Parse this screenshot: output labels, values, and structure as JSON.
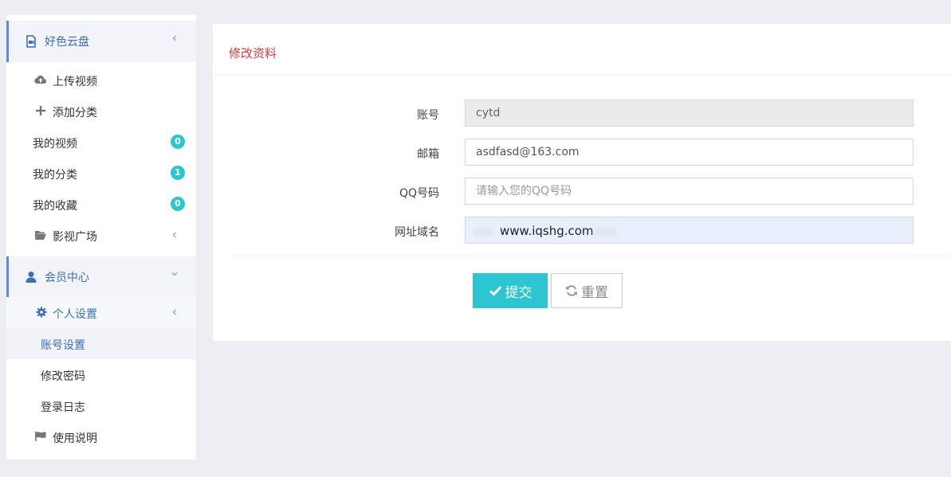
{
  "sidebar": {
    "cloud_group": {
      "label": "好色云盘",
      "icon": "video-file-icon"
    },
    "upload_video": "上传视频",
    "add_category": "添加分类",
    "my_videos": {
      "label": "我的视频",
      "count": "0"
    },
    "my_categories": {
      "label": "我的分类",
      "count": "1"
    },
    "my_favorites": {
      "label": "我的收藏",
      "count": "0"
    },
    "video_plaza": "影视广场",
    "member_group": {
      "label": "会员中心",
      "icon": "user-icon"
    },
    "personal_settings": "个人设置",
    "account_settings": "账号设置",
    "change_password": "修改密码",
    "login_log": "登录日志",
    "instructions": "使用说明"
  },
  "form": {
    "title": "修改资料",
    "account": {
      "label": "账号",
      "value": "cytd"
    },
    "email": {
      "label": "邮箱",
      "value": "asdfasd@163.com"
    },
    "qq": {
      "label": "QQ号码",
      "placeholder": "请输入您的QQ号码"
    },
    "site": {
      "label": "网址域名",
      "value": "www.iqshg.com"
    },
    "submit_label": "提交",
    "reset_label": "重置"
  },
  "colors": {
    "accent": "#2dc5d1",
    "title_red": "#d9373e",
    "nav_blue": "#3a6fb8"
  }
}
